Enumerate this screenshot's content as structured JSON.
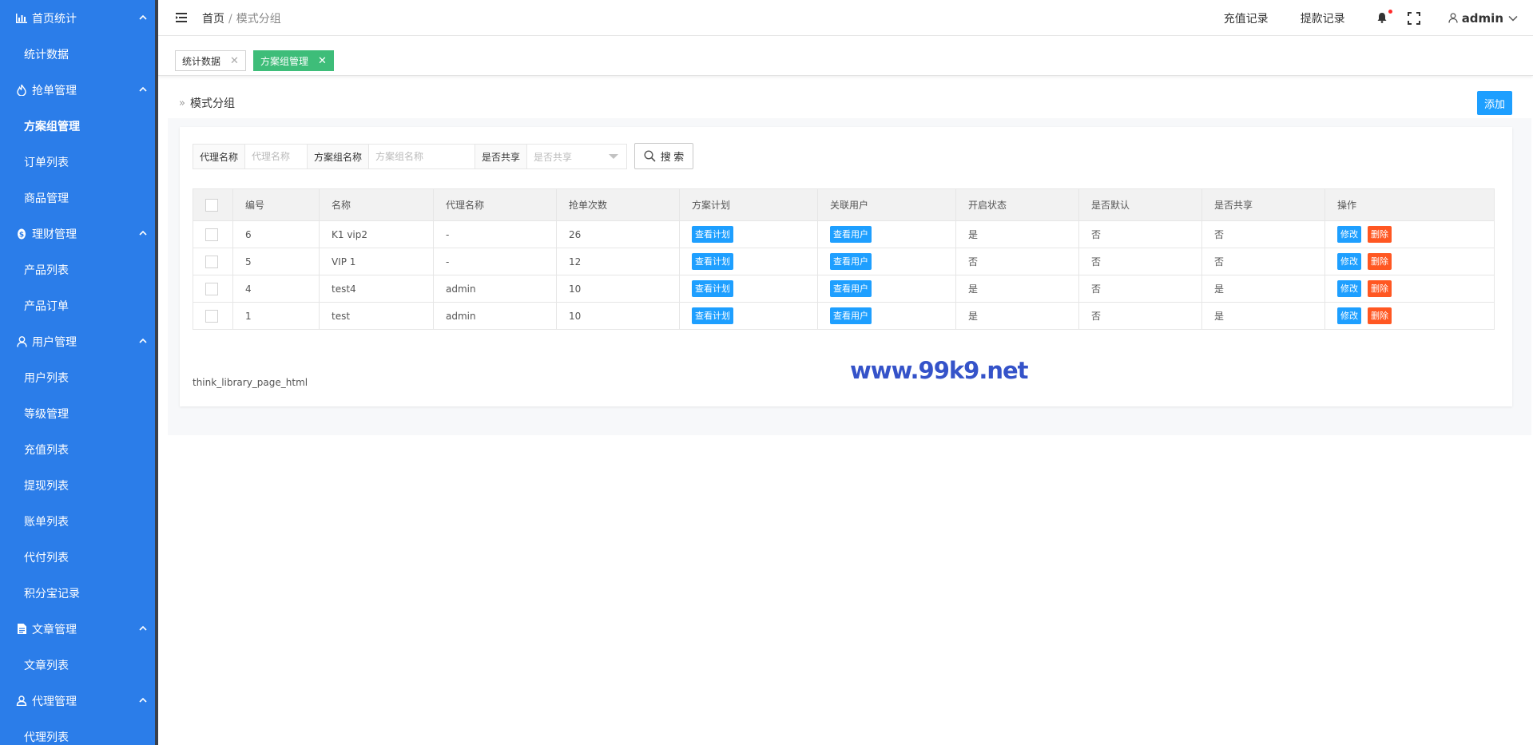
{
  "sidebar": {
    "groups": [
      {
        "label": "首页统计",
        "icon": "bar-chart-icon",
        "items": [
          {
            "label": "统计数据"
          }
        ]
      },
      {
        "label": "抢单管理",
        "icon": "fire-icon",
        "items": [
          {
            "label": "方案组管理",
            "active": true
          },
          {
            "label": "订单列表"
          },
          {
            "label": "商品管理"
          }
        ]
      },
      {
        "label": "理财管理",
        "icon": "coin-icon",
        "items": [
          {
            "label": "产品列表"
          },
          {
            "label": "产品订单"
          }
        ]
      },
      {
        "label": "用户管理",
        "icon": "user-icon",
        "items": [
          {
            "label": "用户列表"
          },
          {
            "label": "等级管理"
          },
          {
            "label": "充值列表"
          },
          {
            "label": "提现列表"
          },
          {
            "label": "账单列表"
          },
          {
            "label": "代付列表"
          },
          {
            "label": "积分宝记录"
          }
        ]
      },
      {
        "label": "文章管理",
        "icon": "document-icon",
        "items": [
          {
            "label": "文章列表"
          }
        ]
      },
      {
        "label": "代理管理",
        "icon": "agent-icon",
        "items": [
          {
            "label": "代理列表"
          }
        ]
      }
    ]
  },
  "header": {
    "breadcrumb_home": "首页",
    "breadcrumb_sep": "/",
    "breadcrumb_current": "模式分组",
    "recharge_link": "充值记录",
    "withdraw_link": "提款记录",
    "user_name": "admin"
  },
  "tabs": [
    {
      "label": "统计数据",
      "active": false
    },
    {
      "label": "方案组管理",
      "active": true
    }
  ],
  "panel": {
    "title": "模式分组",
    "add_label": "添加"
  },
  "search": {
    "agent_label": "代理名称",
    "agent_placeholder": "代理名称",
    "group_label": "方案组名称",
    "group_placeholder": "方案组名称",
    "share_label": "是否共享",
    "share_placeholder": "是否共享",
    "search_label": "搜 索"
  },
  "table": {
    "headers": [
      "编号",
      "名称",
      "代理名称",
      "抢单次数",
      "方案计划",
      "关联用户",
      "开启状态",
      "是否默认",
      "是否共享",
      "操作"
    ],
    "rows": [
      {
        "id": "6",
        "name": "K1 vip2",
        "agent": "-",
        "count": "26",
        "open": "是",
        "default": "否",
        "shared": "否"
      },
      {
        "id": "5",
        "name": "VIP 1",
        "agent": "-",
        "count": "12",
        "open": "否",
        "default": "否",
        "shared": "否"
      },
      {
        "id": "4",
        "name": "test4",
        "agent": "admin",
        "count": "10",
        "open": "是",
        "default": "否",
        "shared": "是"
      },
      {
        "id": "1",
        "name": "test",
        "agent": "admin",
        "count": "10",
        "open": "是",
        "default": "否",
        "shared": "是"
      }
    ],
    "plan_btn": "查看计划",
    "users_btn": "查看用户",
    "edit_btn": "修改",
    "delete_btn": "删除"
  },
  "pager_text": "think_library_page_html",
  "watermark": "www.99k9.net",
  "colors": {
    "sidebar": "#2b7de9",
    "primary": "#1e9fff",
    "danger": "#ff5722",
    "tab_active": "#3ebd79"
  }
}
